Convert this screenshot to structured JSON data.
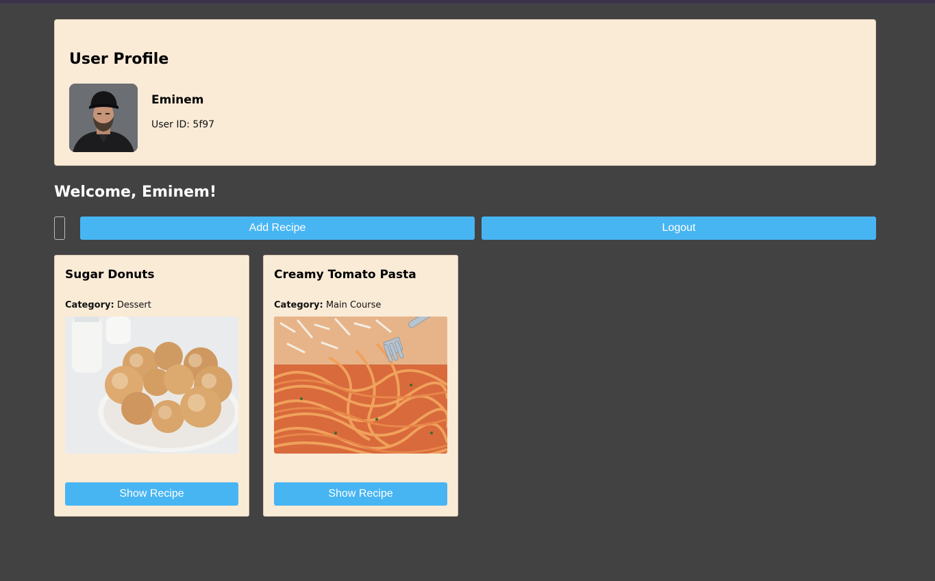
{
  "profile": {
    "title": "User Profile",
    "name": "Eminem",
    "user_id": "User ID: 5f97"
  },
  "welcome": "Welcome, Eminem!",
  "actions": {
    "add_recipe_label": "Add Recipe",
    "logout_label": "Logout"
  },
  "recipes": [
    {
      "title": "Sugar Donuts",
      "category_label": "Category:",
      "category": "Dessert",
      "button_label": "Show Recipe"
    },
    {
      "title": "Creamy Tomato Pasta",
      "category_label": "Category:",
      "category": "Main Course",
      "button_label": "Show Recipe"
    }
  ],
  "colors": {
    "background": "#424242",
    "card": "#faebd7",
    "button": "#48b5f3",
    "button_text": "#ffffff"
  }
}
